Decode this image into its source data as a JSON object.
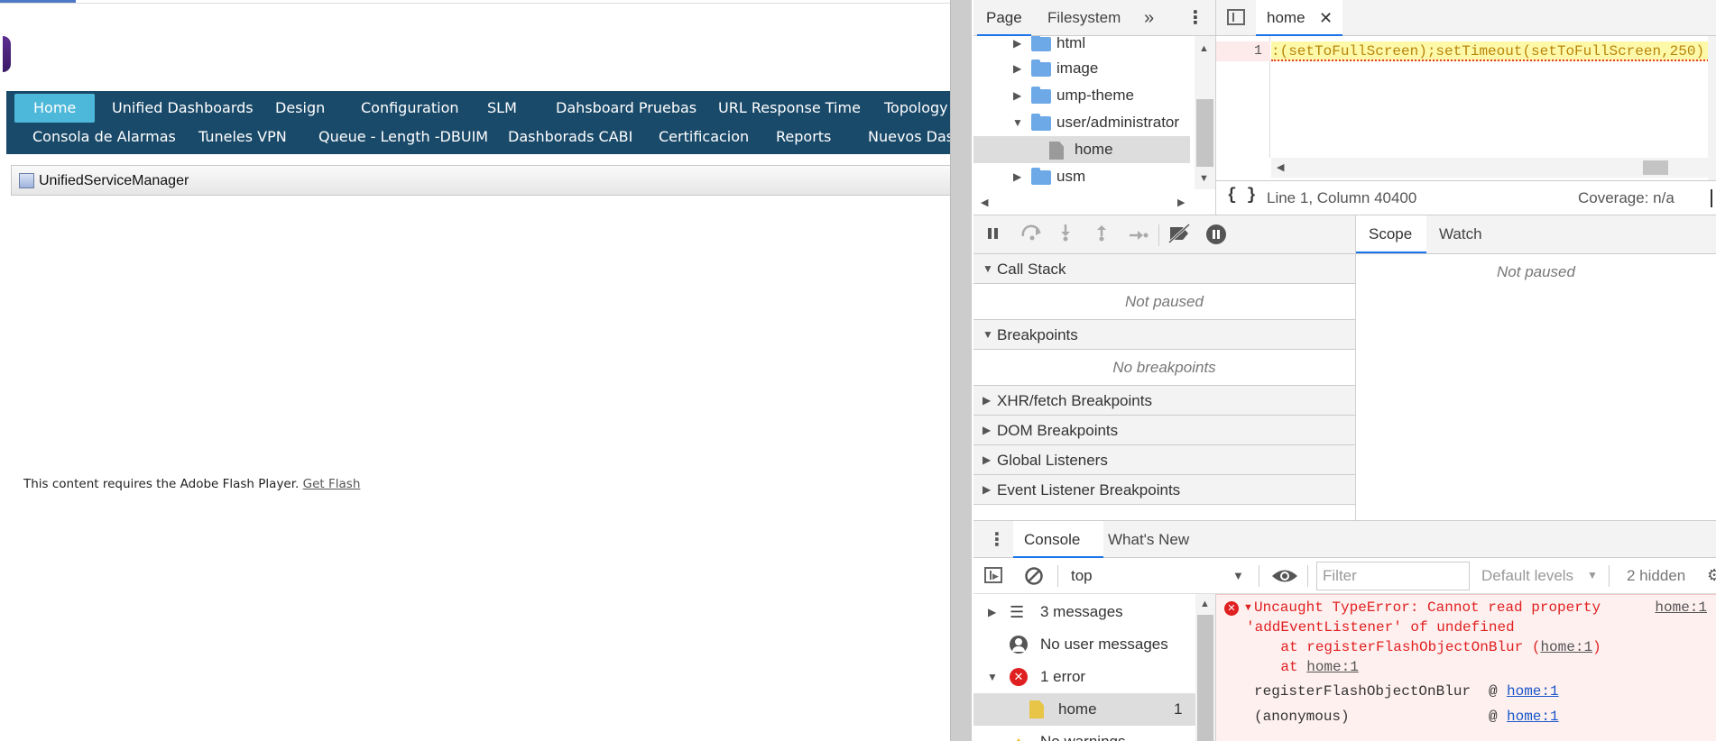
{
  "page": {
    "nav_row_1": [
      "Home",
      "Unified Dashboards",
      "Design",
      "Configuration",
      "SLM",
      "Dahsboard Pruebas",
      "URL Response Time",
      "Topology"
    ],
    "nav_row_2": [
      "Consola de Alarmas",
      "Tuneles VPN",
      "Queue - Length -DBUIM",
      "Dashborads CABI",
      "Certificacion",
      "Reports",
      "Nuevos Dash"
    ],
    "app_title": "UnifiedServiceManager",
    "flash_message": "This content requires the Adobe Flash Player.",
    "flash_link": "Get Flash"
  },
  "devtools": {
    "navigator": {
      "tabs": [
        "Page",
        "Filesystem"
      ],
      "more": "»",
      "menu": "⋮",
      "tree": [
        {
          "label": "html",
          "type": "folder",
          "expanded": false
        },
        {
          "label": "image",
          "type": "folder",
          "expanded": false
        },
        {
          "label": "ump-theme",
          "type": "folder",
          "expanded": false
        },
        {
          "label": "user/administrator",
          "type": "folder",
          "expanded": true
        },
        {
          "label": "home",
          "type": "file",
          "selected": true
        },
        {
          "label": "usm",
          "type": "folder",
          "expanded": false
        }
      ]
    },
    "editor": {
      "tab_label": "home",
      "line_number": "1",
      "code": ":(setToFullScreen);setTimeout(setToFullScreen,250)",
      "status_format": "{ }",
      "status_position": "Line 1, Column 40400",
      "status_coverage": "Coverage: n/a"
    },
    "debugger": {
      "panes": [
        {
          "label": "Call Stack",
          "expanded": true,
          "empty_text": "Not paused"
        },
        {
          "label": "Breakpoints",
          "expanded": true,
          "empty_text": "No breakpoints"
        },
        {
          "label": "XHR/fetch Breakpoints",
          "expanded": false
        },
        {
          "label": "DOM Breakpoints",
          "expanded": false
        },
        {
          "label": "Global Listeners",
          "expanded": false
        },
        {
          "label": "Event Listener Breakpoints",
          "expanded": false
        }
      ],
      "scope_tabs": [
        "Scope",
        "Watch"
      ],
      "scope_empty": "Not paused"
    },
    "console": {
      "tabs": [
        "Console",
        "What's New"
      ],
      "context": "top",
      "filter_placeholder": "Filter",
      "levels": "Default levels",
      "hidden": "2 hidden",
      "sidebar": [
        {
          "label": "3 messages"
        },
        {
          "label": "No user messages"
        },
        {
          "label": "1 error"
        },
        {
          "label": "home",
          "count": "1"
        },
        {
          "label": "No warnings"
        }
      ],
      "error": {
        "line1": "Uncaught TypeError: Cannot read property",
        "line2": "'addEventListener' of undefined",
        "line3_prefix": "    at registerFlashObjectOnBlur (",
        "line3_link": "home:1",
        "line3_suffix": ")",
        "line4_prefix": "    at ",
        "line4_link": "home:1",
        "source": "home:1",
        "trace": [
          {
            "fn": "registerFlashObjectOnBlur",
            "at": "@",
            "link": "home:1"
          },
          {
            "fn": "(anonymous)",
            "at": "@",
            "link": "home:1"
          }
        ]
      }
    }
  },
  "colors": {
    "nav_bg": "#1a4a6a",
    "nav_active": "#4db8d9",
    "error_red": "#e02020",
    "link_blue": "#1a57c9",
    "devtools_accent": "#1a73e8"
  }
}
